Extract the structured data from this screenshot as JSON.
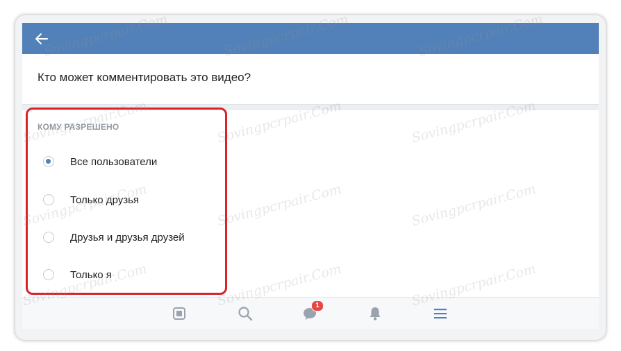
{
  "header": {
    "back_icon": "arrow-left-icon",
    "color": "#5181b8"
  },
  "question": "Кто может комментировать это видео?",
  "section": {
    "title": "КОМУ РАЗРЕШЕНО",
    "options": [
      {
        "label": "Все пользователи",
        "selected": true
      },
      {
        "label": "Только друзья",
        "selected": false
      },
      {
        "label": "Друзья и друзья друзей",
        "selected": false
      },
      {
        "label": "Только я",
        "selected": false
      }
    ]
  },
  "bottom_nav": {
    "items": [
      {
        "icon": "news-icon"
      },
      {
        "icon": "search-icon"
      },
      {
        "icon": "messages-icon",
        "badge": "1"
      },
      {
        "icon": "bell-icon"
      },
      {
        "icon": "menu-icon"
      }
    ],
    "active_color": "#5181b8",
    "badge_color": "#e64646"
  },
  "watermark": "Sovingpcrpair.Com",
  "highlight_color": "#d8232a"
}
